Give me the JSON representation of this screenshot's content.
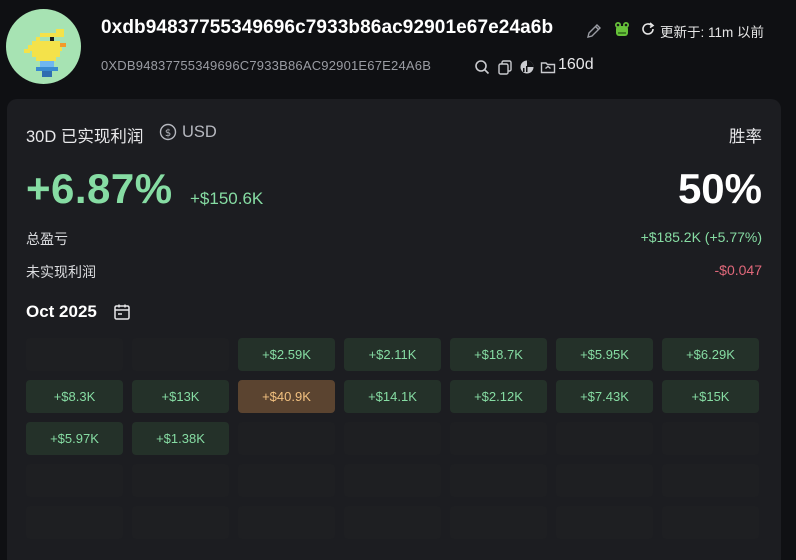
{
  "header": {
    "address": "0xdb94837755349696c7933b86ac92901e67e24a6b",
    "address_upper": "0XDB94837755349696C7933B86AC92901E67E24A6B",
    "updated_text": "更新于: 11m 以前",
    "age": "160d"
  },
  "summary": {
    "pnl_label": "30D 已实现利润",
    "currency": "USD",
    "pnl_percent": "+6.87%",
    "pnl_amount": "+$150.6K",
    "winrate_label": "胜率",
    "winrate_value": "50%",
    "total_pnl_label": "总盈亏",
    "total_pnl_value": "+$185.2K (+5.77%)",
    "unrealized_label": "未实现利润",
    "unrealized_value": "-$0.047"
  },
  "colors": {
    "positive": "#86dca3",
    "negative": "#e0687a",
    "hot_text": "#f1c07f"
  },
  "calendar": {
    "month": "Oct 2025",
    "cells": [
      {
        "label": "",
        "kind": "empty"
      },
      {
        "label": "",
        "kind": "empty"
      },
      {
        "label": "+$2.59K",
        "kind": "pos"
      },
      {
        "label": "+$2.11K",
        "kind": "pos"
      },
      {
        "label": "+$18.7K",
        "kind": "pos"
      },
      {
        "label": "+$5.95K",
        "kind": "pos"
      },
      {
        "label": "+$6.29K",
        "kind": "pos"
      },
      {
        "label": "+$8.3K",
        "kind": "pos"
      },
      {
        "label": "+$13K",
        "kind": "pos"
      },
      {
        "label": "+$40.9K",
        "kind": "hot"
      },
      {
        "label": "+$14.1K",
        "kind": "pos"
      },
      {
        "label": "+$2.12K",
        "kind": "pos"
      },
      {
        "label": "+$7.43K",
        "kind": "pos"
      },
      {
        "label": "+$15K",
        "kind": "pos"
      },
      {
        "label": "+$5.97K",
        "kind": "pos"
      },
      {
        "label": "+$1.38K",
        "kind": "pos"
      },
      {
        "label": "",
        "kind": "empty"
      },
      {
        "label": "",
        "kind": "empty"
      },
      {
        "label": "",
        "kind": "empty"
      },
      {
        "label": "",
        "kind": "empty"
      },
      {
        "label": "",
        "kind": "empty"
      },
      {
        "label": "",
        "kind": "empty"
      },
      {
        "label": "",
        "kind": "empty"
      },
      {
        "label": "",
        "kind": "empty"
      },
      {
        "label": "",
        "kind": "empty"
      },
      {
        "label": "",
        "kind": "empty"
      },
      {
        "label": "",
        "kind": "empty"
      },
      {
        "label": "",
        "kind": "empty"
      },
      {
        "label": "",
        "kind": "empty"
      },
      {
        "label": "",
        "kind": "empty"
      },
      {
        "label": "",
        "kind": "empty"
      },
      {
        "label": "",
        "kind": "empty"
      },
      {
        "label": "",
        "kind": "empty"
      },
      {
        "label": "",
        "kind": "empty"
      },
      {
        "label": "",
        "kind": "empty"
      }
    ]
  },
  "icons": {
    "avatar": "pixel-duck-avatar",
    "edit": "pencil-icon",
    "badge": "frog-icon",
    "refresh": "refresh-icon",
    "search": "search-icon",
    "copy": "copy-icon",
    "chart": "pie-chart-icon",
    "folder": "folder-icon",
    "currency": "currency-swap-icon",
    "calendar": "calendar-icon"
  }
}
